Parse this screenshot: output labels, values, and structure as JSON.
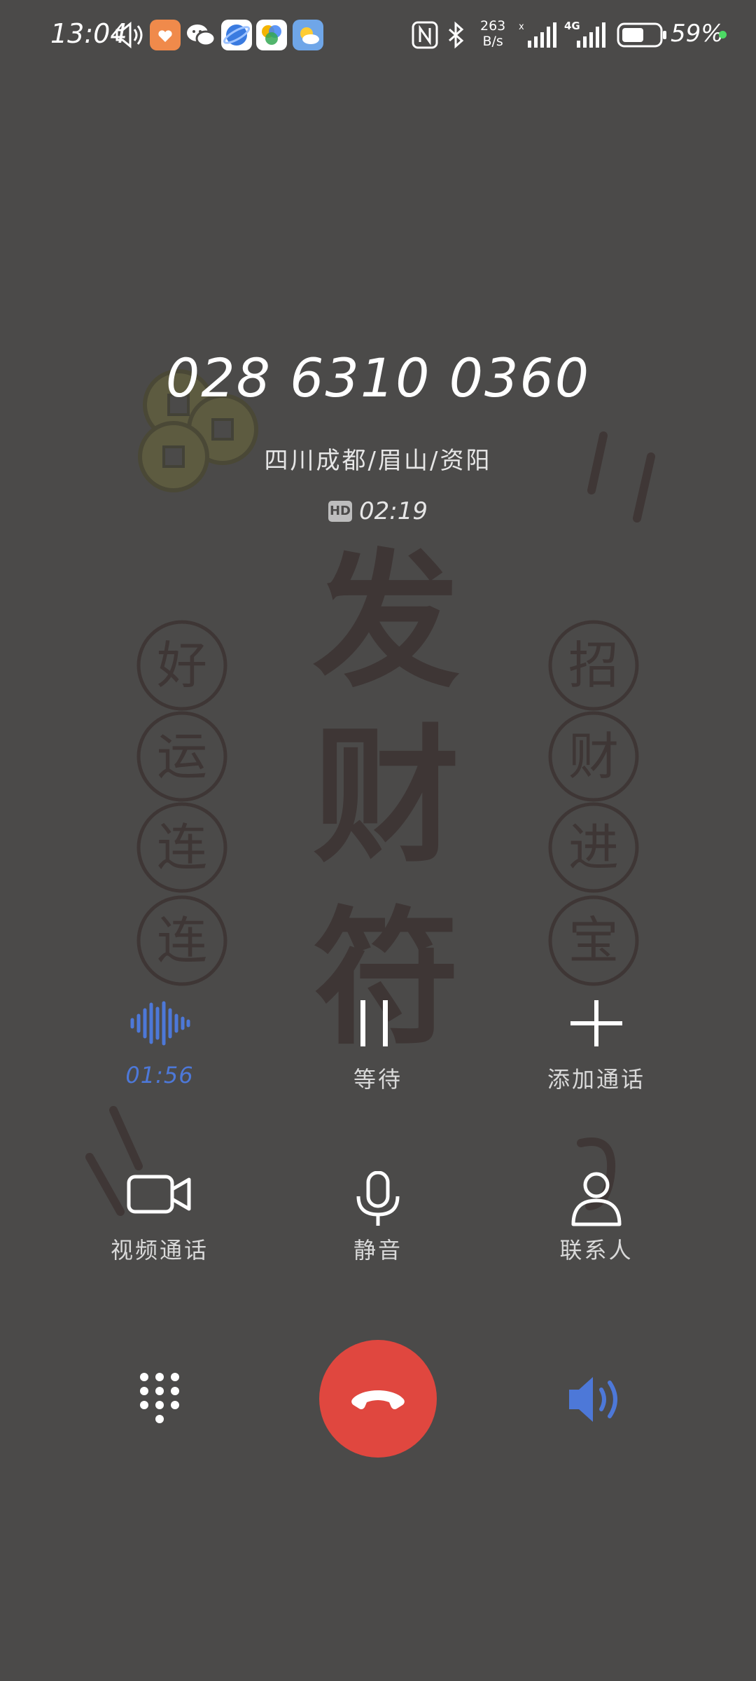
{
  "status_bar": {
    "time": "13:04",
    "net_speed_value": "263",
    "net_speed_unit": "B/s",
    "network_type": "4G",
    "battery_percent": "59%",
    "battery_level": 0.59
  },
  "call": {
    "number": "028 6310 0360",
    "location": "四川成都/眉山/资阳",
    "hd_badge": "HD",
    "duration": "02:19"
  },
  "controls": {
    "recording_time": "01:56",
    "hold_label": "等待",
    "add_call_label": "添加通话",
    "video_call_label": "视频通话",
    "mute_label": "静音",
    "contacts_label": "联系人"
  },
  "wallpaper": {
    "center_text": [
      "发",
      "财",
      "符"
    ],
    "left_seals": [
      "好",
      "运",
      "连",
      "连"
    ],
    "right_seals": [
      "招",
      "财",
      "进",
      "宝"
    ]
  },
  "colors": {
    "background": "#4b4a49",
    "accent_blue": "#4d78d8",
    "end_call_red": "#e0473f",
    "status_dot_green": "#4cd964"
  }
}
